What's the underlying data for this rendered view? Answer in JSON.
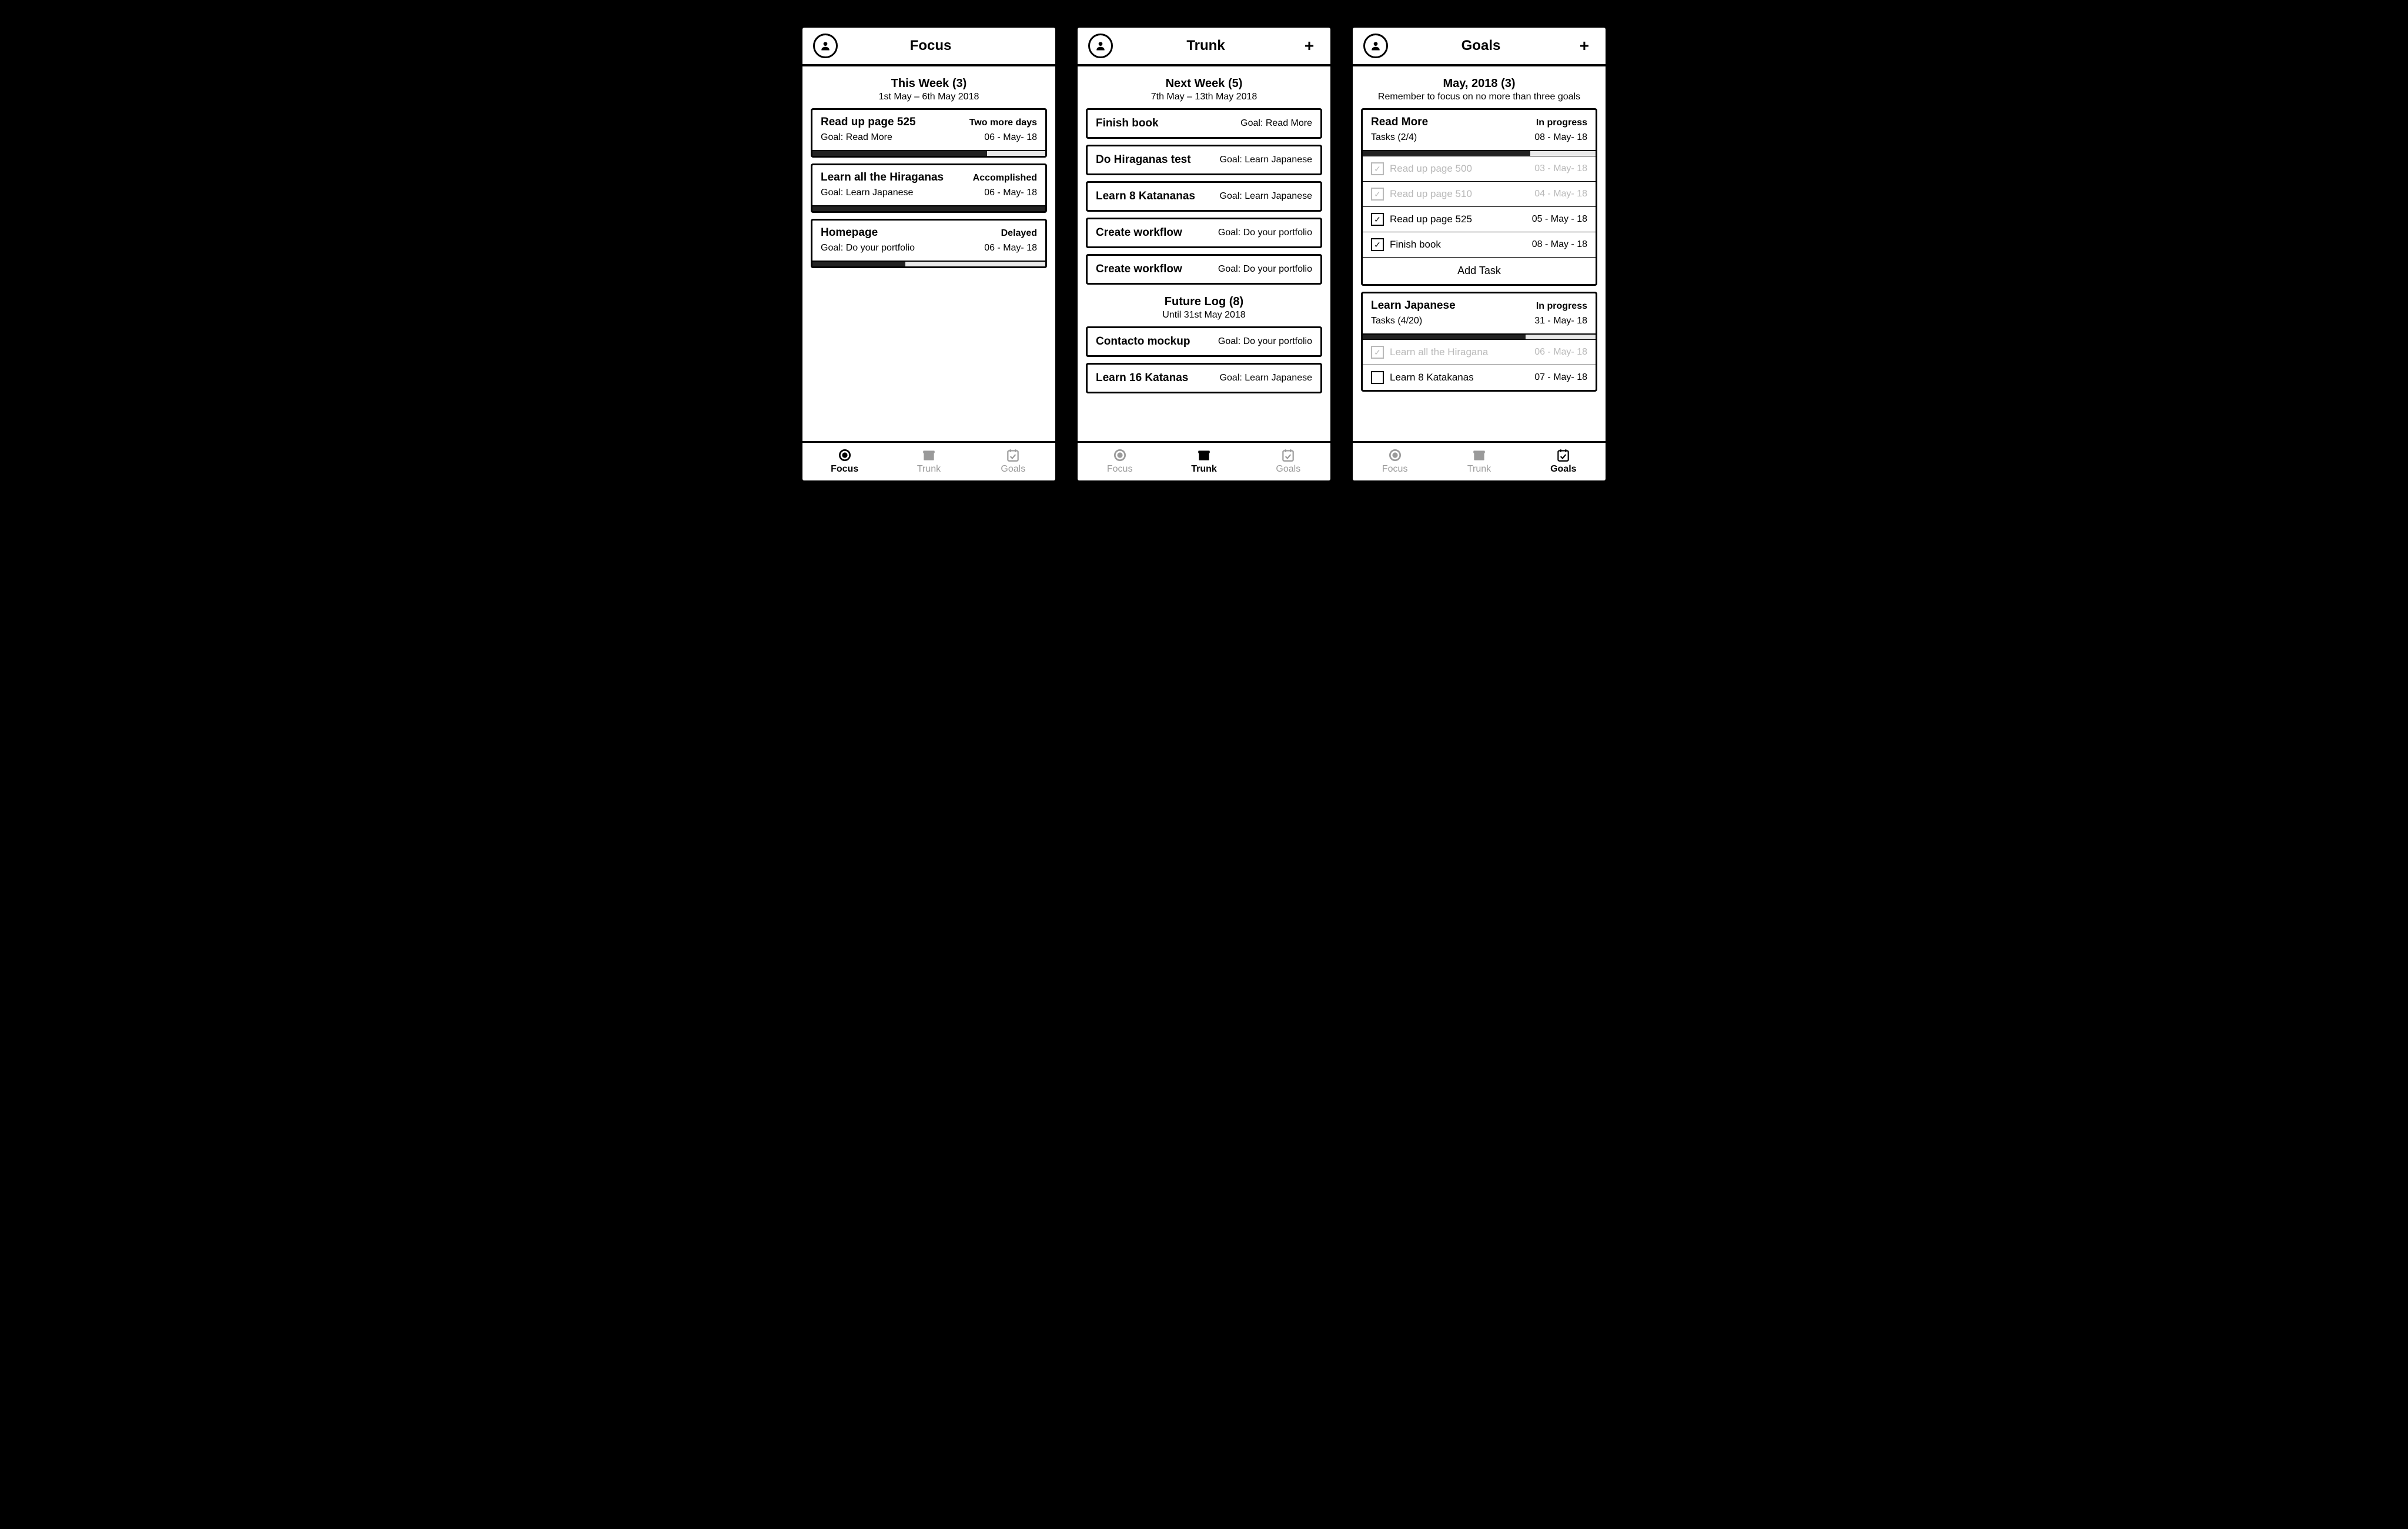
{
  "tabs": {
    "focus": "Focus",
    "trunk": "Trunk",
    "goals": "Goals"
  },
  "focus": {
    "title": "Focus",
    "section": {
      "title": "This Week (3)",
      "sub": "1st May – 6th May 2018"
    },
    "cards": [
      {
        "title": "Read up page 525",
        "goal": "Goal: Read More",
        "status": "Two more days",
        "date": "06 - May- 18",
        "progress": 75
      },
      {
        "title": "Learn all the Hiraganas",
        "goal": "Goal: Learn Japanese",
        "status": "Accomplished",
        "date": "06 - May- 18",
        "progress": 100
      },
      {
        "title": "Homepage",
        "goal": "Goal: Do your portfolio",
        "status": "Delayed",
        "date": "06 - May- 18",
        "progress": 40
      }
    ]
  },
  "trunk": {
    "title": "Trunk",
    "sectionA": {
      "title": "Next Week (5)",
      "sub": "7th May – 13th May 2018"
    },
    "itemsA": [
      {
        "title": "Finish book",
        "goal": "Goal: Read More"
      },
      {
        "title": "Do Hiraganas test",
        "goal": "Goal: Learn Japanese"
      },
      {
        "title": "Learn 8 Katananas",
        "goal": "Goal: Learn Japanese"
      },
      {
        "title": "Create workflow",
        "goal": "Goal: Do your portfolio"
      },
      {
        "title": "Create workflow",
        "goal": "Goal: Do your portfolio"
      }
    ],
    "sectionB": {
      "title": "Future Log (8)",
      "sub": "Until  31st May 2018"
    },
    "itemsB": [
      {
        "title": "Contacto mockup",
        "goal": "Goal: Do your portfolio"
      },
      {
        "title": "Learn 16 Katanas",
        "goal": "Goal: Learn Japanese"
      }
    ]
  },
  "goals": {
    "title": "Goals",
    "section": {
      "title": "May, 2018 (3)",
      "sub": "Remember to focus on no more than three goals"
    },
    "addTask": "Add Task",
    "g1": {
      "title": "Read More",
      "status": "In progress",
      "tasks": "Tasks (2/4)",
      "date": "08 - May- 18",
      "progress": 72,
      "subs": [
        {
          "label": "Read up page 500",
          "date": "03 - May- 18",
          "done": true,
          "chk": "✓"
        },
        {
          "label": "Read up page 510",
          "date": "04 - May- 18",
          "done": true,
          "chk": "✓"
        },
        {
          "label": "Read up page 525",
          "date": "05 - May - 18",
          "done": false,
          "chk": "✓"
        },
        {
          "label": "Finish book",
          "date": "08 - May - 18",
          "done": false,
          "chk": "✓"
        }
      ]
    },
    "g2": {
      "title": "Learn Japanese",
      "status": "In progress",
      "tasks": "Tasks (4/20)",
      "date": "31 - May- 18",
      "progress": 70,
      "subs": [
        {
          "label": "Learn all the Hiragana",
          "date": "06 - May- 18",
          "done": true,
          "chk": "✓"
        },
        {
          "label": "Learn 8 Katakanas",
          "date": "07 - May- 18",
          "done": false,
          "chk": ""
        }
      ]
    }
  }
}
